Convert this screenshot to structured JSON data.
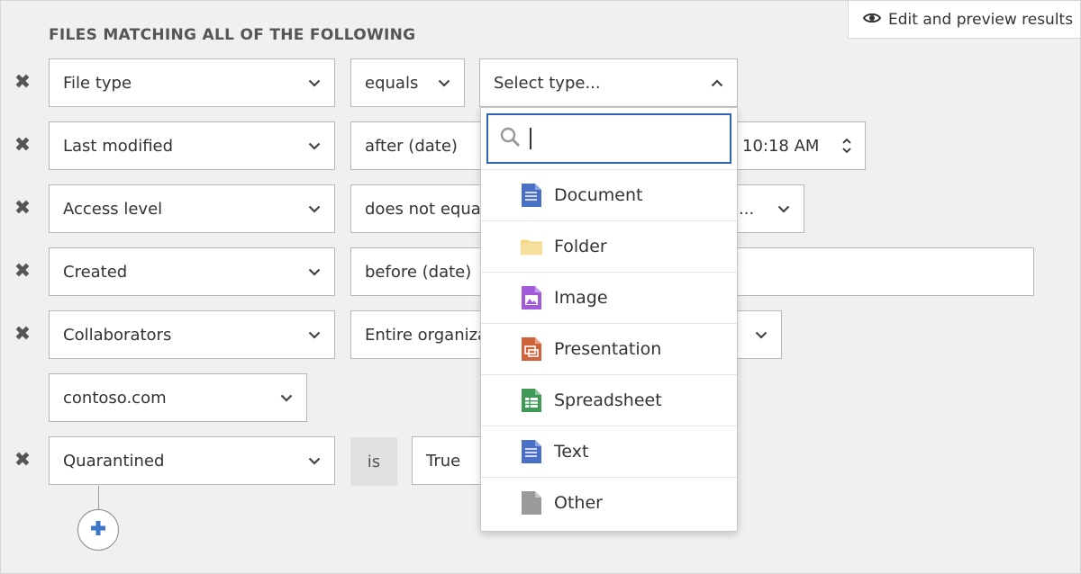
{
  "heading": "FILES MATCHING ALL OF THE FOLLOWING",
  "preview_button": {
    "label": "Edit and preview results",
    "icon": "eye-icon"
  },
  "rows": [
    {
      "field": "File type",
      "operator": "equals",
      "value": "Select type..."
    },
    {
      "field": "Last modified",
      "operator": "after (date)",
      "time": "10:18 AM"
    },
    {
      "field": "Access level",
      "operator": "does not equal",
      "value": "..."
    },
    {
      "field": "Created",
      "operator": "before (date)"
    },
    {
      "field": "Collaborators",
      "operator": "Entire organiza",
      "extra": "contoso.com"
    },
    {
      "field": "Quarantined",
      "operator": "is",
      "value": "True"
    }
  ],
  "dropdown": {
    "search_value": "",
    "options": [
      {
        "label": "Document",
        "icon": "document-icon",
        "color": "#4a6fc7"
      },
      {
        "label": "Folder",
        "icon": "folder-icon",
        "color": "#f2d786"
      },
      {
        "label": "Image",
        "icon": "image-icon",
        "color": "#a25ad9"
      },
      {
        "label": "Presentation",
        "icon": "presentation-icon",
        "color": "#d0623a"
      },
      {
        "label": "Spreadsheet",
        "icon": "spreadsheet-icon",
        "color": "#3f9a55"
      },
      {
        "label": "Text",
        "icon": "text-icon",
        "color": "#4a6fc7"
      },
      {
        "label": "Other",
        "icon": "other-file-icon",
        "color": "#9a9a9a"
      }
    ]
  },
  "colors": {
    "accent": "#2f63b8",
    "add_plus": "#3b78c9"
  }
}
